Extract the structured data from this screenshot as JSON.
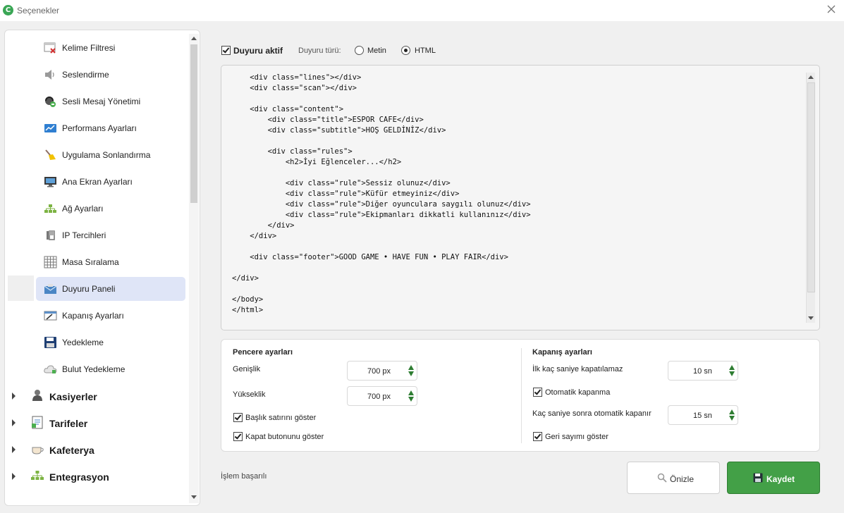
{
  "window": {
    "title": "Seçenekler",
    "logo_letter": "C"
  },
  "sidebar": {
    "items": [
      {
        "label": "Kelime Filtresi",
        "icon": "word-filter-icon"
      },
      {
        "label": "Seslendirme",
        "icon": "speaker-icon"
      },
      {
        "label": "Sesli Mesaj Yönetimi",
        "icon": "voice-message-icon"
      },
      {
        "label": "Performans Ayarları",
        "icon": "performance-icon"
      },
      {
        "label": "Uygulama Sonlandırma",
        "icon": "broom-icon"
      },
      {
        "label": "Ana Ekran Ayarları",
        "icon": "monitor-icon"
      },
      {
        "label": "Ağ Ayarları",
        "icon": "network-icon"
      },
      {
        "label": "IP Tercihleri",
        "icon": "ip-icon"
      },
      {
        "label": "Masa Sıralama",
        "icon": "grid-icon"
      },
      {
        "label": "Duyuru Paneli",
        "icon": "announcement-icon",
        "active": true
      },
      {
        "label": "Kapanış Ayarları",
        "icon": "shutdown-icon"
      },
      {
        "label": "Yedekleme",
        "icon": "floppy-icon"
      },
      {
        "label": "Bulut Yedekleme",
        "icon": "cloud-icon"
      }
    ],
    "groups": [
      {
        "label": "Kasiyerler",
        "icon": "cashier-icon"
      },
      {
        "label": "Tarifeler",
        "icon": "tariff-icon"
      },
      {
        "label": "Kafeterya",
        "icon": "cafe-icon"
      },
      {
        "label": "Entegrasyon",
        "icon": "integration-icon"
      }
    ]
  },
  "options": {
    "active_label": "Duyuru aktif",
    "active_checked": true,
    "type_label": "Duyuru türü:",
    "type_text": "Metin",
    "type_html": "HTML",
    "selected_type": "HTML"
  },
  "editor": {
    "code": "    <div class=\"lines\"></div>\n    <div class=\"scan\"></div>\n\n    <div class=\"content\">\n        <div class=\"title\">ESPOR CAFE</div>\n        <div class=\"subtitle\">HOŞ GELDİNİZ</div>\n\n        <div class=\"rules\">\n            <h2>İyi Eğlenceler...</h2>\n\n            <div class=\"rule\">Sessiz olunuz</div>\n            <div class=\"rule\">Küfür etmeyiniz</div>\n            <div class=\"rule\">Diğer oyunculara saygılı olunuz</div>\n            <div class=\"rule\">Ekipmanları dikkatli kullanınız</div>\n        </div>\n    </div>\n\n    <div class=\"footer\">GOOD GAME • HAVE FUN • PLAY FAIR</div>\n\n</div>\n\n</body>\n</html>"
  },
  "window_settings": {
    "title": "Pencere ayarları",
    "width_label": "Genişlik",
    "width_value": "700 px",
    "height_label": "Yükseklik",
    "height_value": "700 px",
    "show_titlebar_label": "Başlık satırını göster",
    "show_titlebar": true,
    "show_close_label": "Kapat butonunu göster",
    "show_close": true
  },
  "close_settings": {
    "title": "Kapanış ayarları",
    "no_close_label": "İlk kaç saniye kapatılamaz",
    "no_close_value": "10 sn",
    "auto_close_label": "Otomatik kapanma",
    "auto_close": true,
    "auto_close_after_label": "Kaç saniye sonra otomatik kapanır",
    "auto_close_after_value": "15 sn",
    "countdown_label": "Geri sayımı göster",
    "countdown": true
  },
  "status_text": "İşlem başarılı",
  "buttons": {
    "preview": "Önizle",
    "save": "Kaydet"
  },
  "colors": {
    "accent_green": "#43a047",
    "active_item": "#dfe5f7",
    "spinner_arrow": "#2e7d32"
  }
}
